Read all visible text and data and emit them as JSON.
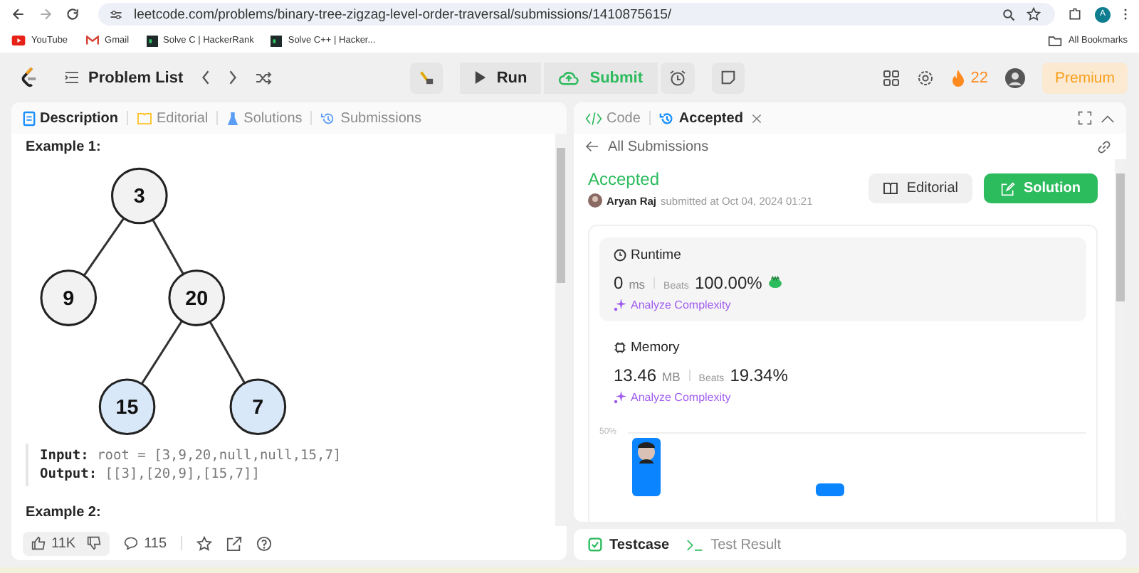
{
  "browser": {
    "url": "leetcode.com/problems/binary-tree-zigzag-level-order-traversal/submissions/1410875615/",
    "profile_initial": "A",
    "bookmarks": [
      {
        "label": "YouTube",
        "kind": "youtube"
      },
      {
        "label": "Gmail",
        "kind": "gmail"
      },
      {
        "label": "Solve C | HackerRank",
        "kind": "hackerrank"
      },
      {
        "label": "Solve C++ | Hacker...",
        "kind": "hackerrank"
      }
    ],
    "all_bookmarks": "All Bookmarks"
  },
  "toolbar": {
    "problem_list": "Problem List",
    "run": "Run",
    "submit": "Submit",
    "streak": "22",
    "premium": "Premium"
  },
  "left_panel": {
    "tabs": [
      {
        "label": "Description",
        "selected": true
      },
      {
        "label": "Editorial",
        "selected": false
      },
      {
        "label": "Solutions",
        "selected": false
      },
      {
        "label": "Submissions",
        "selected": false
      }
    ],
    "example_1": "Example 1:",
    "tree": [
      {
        "label": "3",
        "highlighted": false
      },
      {
        "label": "9",
        "highlighted": false
      },
      {
        "label": "20",
        "highlighted": false
      },
      {
        "label": "15",
        "highlighted": true
      },
      {
        "label": "7",
        "highlighted": true
      }
    ],
    "input_label": "Input:",
    "input_value": "root = [3,9,20,null,null,15,7]",
    "output_label": "Output:",
    "output_value": "[[3],[20,9],[15,7]]",
    "example_2": "Example 2:",
    "likes": "11K",
    "comments": "115"
  },
  "right_panel": {
    "tabs": [
      {
        "label": "Code",
        "selected": false
      },
      {
        "label": "Accepted",
        "selected": true
      }
    ],
    "back_link": "All Submissions",
    "status": "Accepted",
    "author": "Aryan Raj",
    "submitted": "submitted at Oct 04, 2024 01:21",
    "editorial_button": "Editorial",
    "solution_button": "Solution",
    "runtime": {
      "title": "Runtime",
      "value": "0",
      "unit": "ms",
      "beats_label": "Beats",
      "beats": "100.00%",
      "analyze": "Analyze Complexity"
    },
    "memory": {
      "title": "Memory",
      "value": "13.46",
      "unit": "MB",
      "beats_label": "Beats",
      "beats": "19.34%",
      "analyze": "Analyze Complexity"
    },
    "chart_axis_label": "50%",
    "bottom_tabs": [
      {
        "label": "Testcase",
        "selected": true
      },
      {
        "label": "Test Result",
        "selected": false
      }
    ]
  }
}
